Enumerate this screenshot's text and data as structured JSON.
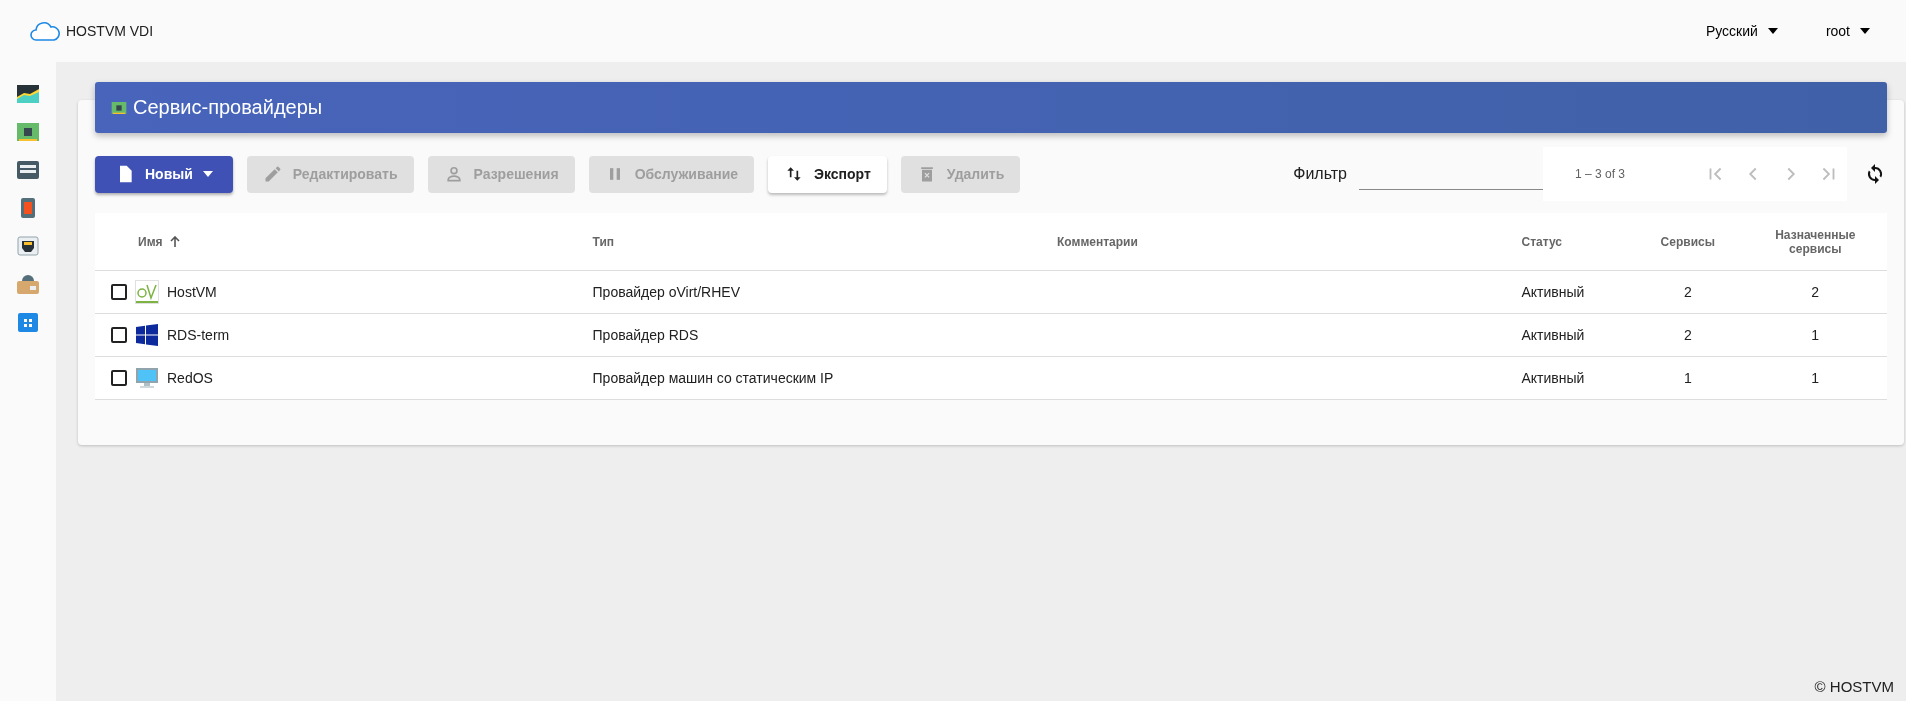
{
  "header": {
    "brand": "HOSTVM VDI",
    "language": "Русский",
    "user": "root"
  },
  "sidebar": {
    "items": [
      {
        "kind": "dashboard"
      },
      {
        "kind": "chip"
      },
      {
        "kind": "server"
      },
      {
        "kind": "switch"
      },
      {
        "kind": "network"
      },
      {
        "kind": "package"
      },
      {
        "kind": "calendar"
      }
    ]
  },
  "page": {
    "title": "Сервис-провайдеры"
  },
  "toolbar": {
    "buttons": [
      {
        "label": "Новый",
        "kind": "new",
        "disabled": false
      },
      {
        "label": "Редактировать",
        "kind": "edit",
        "disabled": true
      },
      {
        "label": "Разрешения",
        "kind": "permissions",
        "disabled": true
      },
      {
        "label": "Обслуживание",
        "kind": "maintenance",
        "disabled": true
      },
      {
        "label": "Экспорт",
        "kind": "export",
        "disabled": false
      },
      {
        "label": "Удалить",
        "kind": "delete",
        "disabled": true
      }
    ],
    "filter": {
      "label": "Фильтр"
    },
    "paginator": {
      "range": "1 – 3 of 3"
    }
  },
  "table": {
    "columns": [
      {
        "label": "Имя",
        "sorted": true
      },
      {
        "label": "Тип",
        "sorted": false
      },
      {
        "label": "Комментарии",
        "sorted": false
      },
      {
        "label": "Статус",
        "sorted": false
      },
      {
        "label": "Сервисы",
        "sorted": false
      },
      {
        "label": "Назначенные сервисы",
        "sorted": false
      }
    ],
    "rows": [
      {
        "checked": false,
        "kind": "ovirt",
        "name": "HostVM",
        "type": "Провайдер oVirt/RHEV",
        "status": "Активный",
        "services": "2",
        "assigned": "2"
      },
      {
        "checked": false,
        "kind": "windows",
        "name": "RDS-term",
        "type": "Провайдер RDS",
        "status": "Активный",
        "services": "2",
        "assigned": "1"
      },
      {
        "checked": false,
        "kind": "monitor",
        "name": "RedOS",
        "type": "Провайдер машин со статическим IP",
        "status": "Активный",
        "services": "1",
        "assigned": "1"
      }
    ]
  },
  "footer": {
    "copyright": "© HOSTVM"
  }
}
